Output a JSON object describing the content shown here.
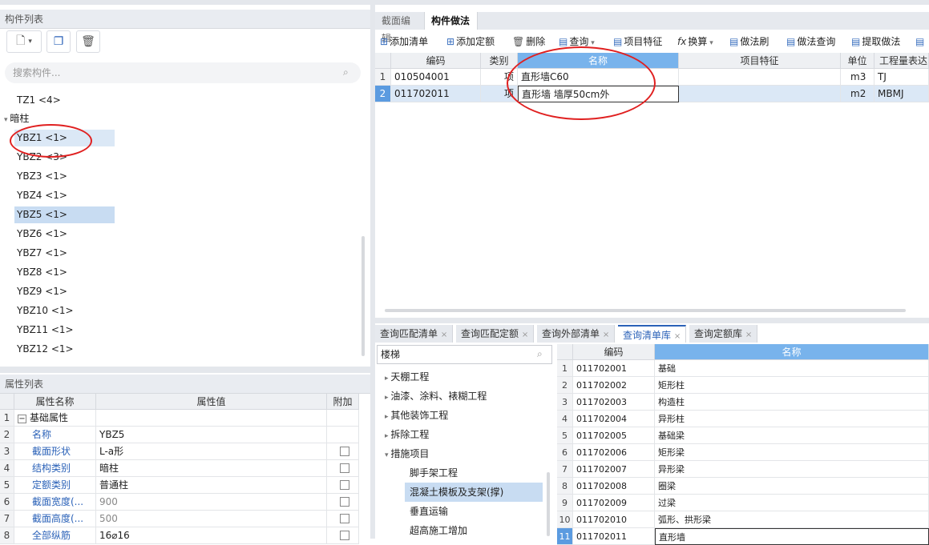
{
  "left_panel": {
    "title": "构件列表",
    "search_placeholder": "搜索构件...",
    "tree": [
      {
        "label": "TZ1 <4>"
      },
      {
        "label": "暗柱",
        "group": true
      },
      {
        "label": "YBZ1 <1>"
      },
      {
        "label": "YBZ2 <3>"
      },
      {
        "label": "YBZ3 <1>"
      },
      {
        "label": "YBZ4 <1>"
      },
      {
        "label": "YBZ5 <1>"
      },
      {
        "label": "YBZ6 <1>"
      },
      {
        "label": "YBZ7 <1>"
      },
      {
        "label": "YBZ8 <1>"
      },
      {
        "label": "YBZ9 <1>"
      },
      {
        "label": "YBZ10 <1>"
      },
      {
        "label": "YBZ11 <1>"
      },
      {
        "label": "YBZ12 <1>"
      }
    ]
  },
  "props_panel": {
    "title": "属性列表",
    "headers": [
      "属性名称",
      "属性值",
      "附加"
    ],
    "rows": [
      {
        "n": "1",
        "name": "基础属性",
        "value": ""
      },
      {
        "n": "2",
        "name": "名称",
        "value": "YBZ5"
      },
      {
        "n": "3",
        "name": "截面形状",
        "value": "L-a形"
      },
      {
        "n": "4",
        "name": "结构类别",
        "value": "暗柱"
      },
      {
        "n": "5",
        "name": "定额类别",
        "value": "普通柱"
      },
      {
        "n": "6",
        "name": "截面宽度(...",
        "value": "900"
      },
      {
        "n": "7",
        "name": "截面高度(...",
        "value": "500"
      },
      {
        "n": "8",
        "name": "全部纵筋",
        "value": "16⌀16"
      }
    ]
  },
  "right_tabs": [
    "截面编辑",
    "构件做法"
  ],
  "toolbar": [
    "添加清单",
    "添加定额",
    "删除",
    "查询",
    "项目特征",
    "换算",
    "做法刷",
    "做法查询",
    "提取做法"
  ],
  "method_grid": {
    "headers": [
      "编码",
      "类别",
      "名称",
      "项目特征",
      "单位",
      "工程量表达"
    ],
    "rows": [
      {
        "n": "1",
        "code": "010504001",
        "type": "项",
        "name": "直形墙C60",
        "feature": "",
        "unit": "m3",
        "expr": "TJ"
      },
      {
        "n": "2",
        "code": "011702011",
        "type": "项",
        "name": "直形墙 墙厚50cm外",
        "feature": "",
        "unit": "m2",
        "expr": "MBMJ"
      }
    ]
  },
  "bottom_tabs": [
    "查询匹配清单",
    "查询匹配定额",
    "查询外部清单",
    "查询清单库",
    "查询定额库"
  ],
  "library": {
    "search_value": "楼梯",
    "categories": [
      "天棚工程",
      "油漆、涂料、裱糊工程",
      "其他装饰工程",
      "拆除工程",
      "措施项目"
    ],
    "subcategories": [
      "脚手架工程",
      "混凝土模板及支架(撑)",
      "垂直运输",
      "超高施工增加"
    ],
    "headers": [
      "编码",
      "名称"
    ],
    "rows": [
      {
        "n": "1",
        "code": "011702001",
        "name": "基础"
      },
      {
        "n": "2",
        "code": "011702002",
        "name": "矩形柱"
      },
      {
        "n": "3",
        "code": "011702003",
        "name": "构造柱"
      },
      {
        "n": "4",
        "code": "011702004",
        "name": "异形柱"
      },
      {
        "n": "5",
        "code": "011702005",
        "name": "基础梁"
      },
      {
        "n": "6",
        "code": "011702006",
        "name": "矩形梁"
      },
      {
        "n": "7",
        "code": "011702007",
        "name": "异形梁"
      },
      {
        "n": "8",
        "code": "011702008",
        "name": "圈梁"
      },
      {
        "n": "9",
        "code": "011702009",
        "name": "过梁"
      },
      {
        "n": "10",
        "code": "011702010",
        "name": "弧形、拱形梁"
      },
      {
        "n": "11",
        "code": "011702011",
        "name": "直形墙"
      }
    ]
  },
  "colors": {
    "accent": "#2b62b8",
    "name_header": "#78b3ec",
    "annotation": "#e02020"
  }
}
